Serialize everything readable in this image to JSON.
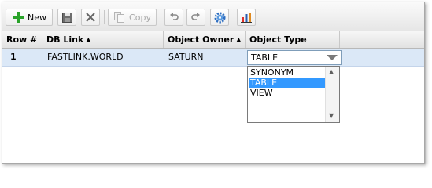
{
  "toolbar": {
    "new_label": "New",
    "copy_label": "Copy",
    "icons": {
      "new": "plus-icon",
      "save": "save-icon",
      "delete": "delete-x-icon",
      "copy": "copy-icon",
      "undo": "undo-icon",
      "redo": "redo-icon",
      "settings": "gear-icon",
      "chart": "bar-chart-icon"
    }
  },
  "grid": {
    "columns": {
      "row_num": "Row #",
      "db_link": "DB Link",
      "object_owner": "Object Owner",
      "object_type": "Object Type"
    },
    "sort_arrow": "▲",
    "rows": [
      {
        "row_num": "1",
        "db_link": "FASTLINK.WORLD",
        "object_owner": "SATURN",
        "object_type": "TABLE"
      }
    ]
  },
  "dropdown": {
    "selected": "TABLE",
    "options": [
      "SYNONYM",
      "TABLE",
      "VIEW"
    ]
  },
  "colors": {
    "selected_row": "#dbe8f7",
    "selected_option": "#3399ff",
    "new_icon": "#2aa32a"
  }
}
